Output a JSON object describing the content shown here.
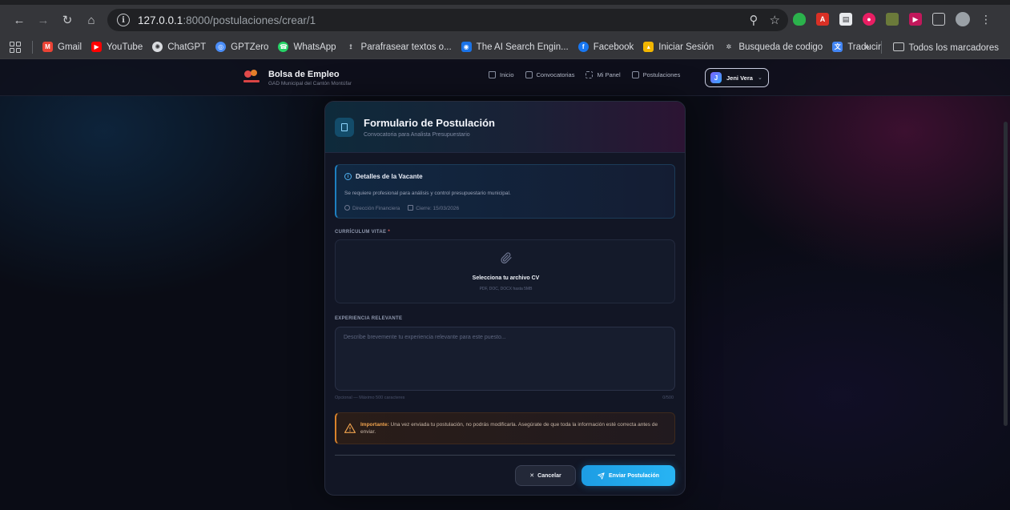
{
  "browser": {
    "url_host": "127.0.0.1",
    "url_rest": ":8000/postulaciones/crear/1",
    "bookmarks": [
      "Gmail",
      "YouTube",
      "ChatGPT",
      "GPTZero",
      "WhatsApp",
      "Parafrasear textos o...",
      "The AI Search Engin...",
      "Facebook",
      "Iniciar Sesión",
      "Busqueda de codigo",
      "Traducir"
    ],
    "bookmarks_overflow": "»",
    "all_bookmarks": "Todos los marcadores"
  },
  "app": {
    "brand_title": "Bolsa de Empleo",
    "brand_subtitle": "GAD Municipal del Cantón Montúfar",
    "nav": [
      "Inicio",
      "Convocatorias",
      "Mi Panel",
      "Postulaciones"
    ],
    "user": {
      "initial": "J",
      "name": "Jeni Vera"
    }
  },
  "form": {
    "title": "Formulario de Postulación",
    "subtitle": "Convocatoria para Analista Presupuestario",
    "vacancy": {
      "heading": "Detalles de la Vacante",
      "description": "Se requiere profesional para análisis y control presupuestario municipal.",
      "department": "Dirección Financiera",
      "deadline": "Cierre: 15/03/2026"
    },
    "cv_label": "CURRÍCULUM VITAE",
    "cv_required": "*",
    "upload_title": "Selecciona tu archivo CV",
    "upload_hint": "PDF, DOC, DOCX hasta 5MB",
    "experience_label": "EXPERIENCIA RELEVANTE",
    "experience_placeholder": "Describe brevemente tu experiencia relevante para este puesto...",
    "experience_hint": "Opcional — Máximo 500 caracteres",
    "experience_counter": "0/500",
    "warning_strong": "Importante:",
    "warning_text": " Una vez enviada tu postulación, no podrás modificarla. Asegúrate de que toda la información esté correcta antes de enviar.",
    "cancel_label": "Cancelar",
    "submit_label": "Enviar Postulación"
  },
  "colors": {
    "accent": "#28b4f3",
    "warning": "#d9822b",
    "card_bg": "#121625"
  }
}
